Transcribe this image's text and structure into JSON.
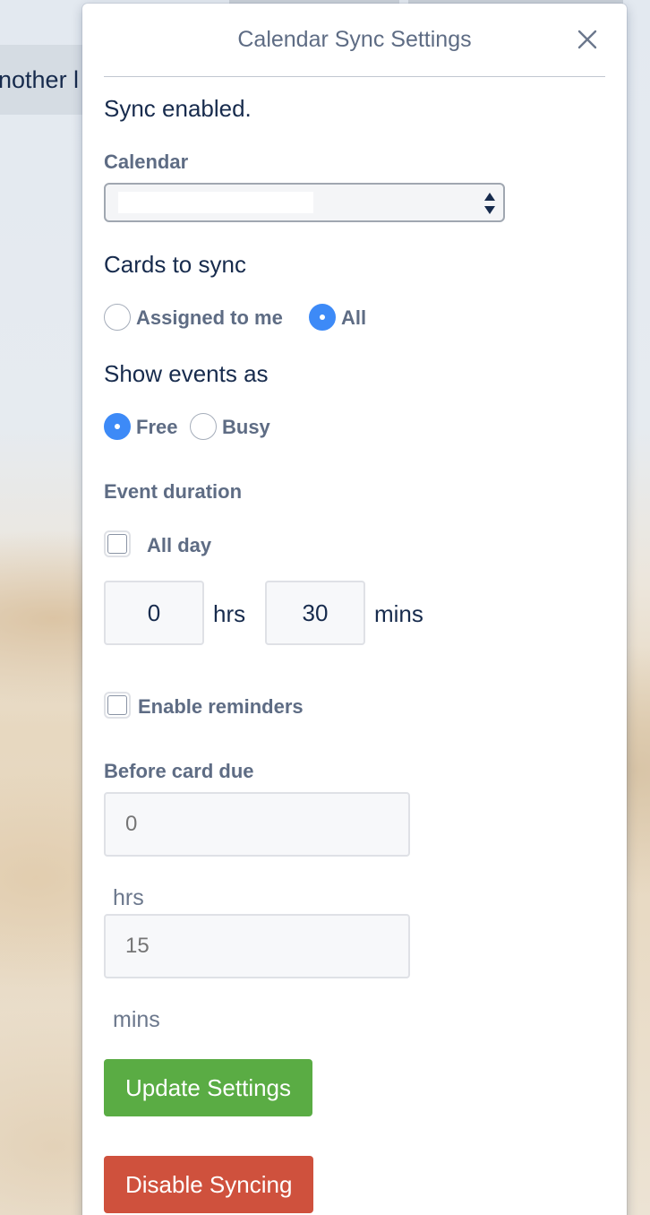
{
  "background": {
    "list_title_fragment": "nother l"
  },
  "popover": {
    "title": "Calendar Sync Settings",
    "close_icon": "close-icon",
    "status_text": "Sync enabled.",
    "calendar": {
      "label": "Calendar",
      "selected_value": ""
    },
    "cards_to_sync": {
      "heading": "Cards to sync",
      "options": [
        {
          "label": "Assigned to me",
          "checked": false
        },
        {
          "label": "All",
          "checked": true
        }
      ]
    },
    "show_events_as": {
      "heading": "Show events as",
      "options": [
        {
          "label": "Free",
          "checked": true
        },
        {
          "label": "Busy",
          "checked": false
        }
      ]
    },
    "event_duration": {
      "label": "Event duration",
      "all_day_label": "All day",
      "all_day_checked": false,
      "hours_value": "0",
      "hours_unit": "hrs",
      "minutes_value": "30",
      "minutes_unit": "mins"
    },
    "reminders": {
      "enable_label": "Enable reminders",
      "enabled": false,
      "before_label": "Before card due",
      "hours_placeholder": "0",
      "hours_unit": "hrs",
      "minutes_placeholder": "15",
      "minutes_unit": "mins"
    },
    "update_button": "Update Settings",
    "disable_button": "Disable Syncing"
  },
  "colors": {
    "primary_text": "#172b4d",
    "muted_text": "#5e6c84",
    "radio_checked": "#3d8af7",
    "update_button": "#5aac44",
    "disable_button": "#cf513d"
  }
}
